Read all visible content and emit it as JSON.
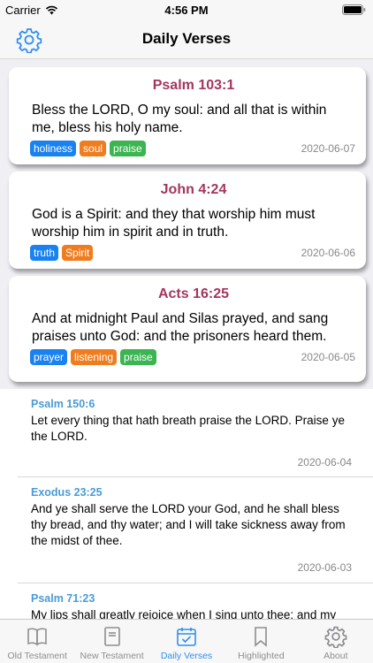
{
  "status": {
    "carrier": "Carrier",
    "time": "4:56 PM"
  },
  "nav": {
    "title": "Daily Verses"
  },
  "colors": {
    "accent": "#2f8ff0",
    "reference": "#a3365c",
    "list_reference": "#4a9bd6",
    "tag_blue": "#1a82f0",
    "tag_orange": "#ef7d20",
    "tag_green": "#3bb452"
  },
  "cards": [
    {
      "reference": "Psalm 103:1",
      "text": "Bless the LORD, O my soul: and all that is within me, bless his holy name.",
      "tags": [
        "holiness",
        "soul",
        "praise"
      ],
      "date": "2020-06-07"
    },
    {
      "reference": "John 4:24",
      "text": "God is a Spirit: and they that worship him must worship him in spirit and in truth.",
      "tags": [
        "truth",
        "Spirit"
      ],
      "date": "2020-06-06"
    },
    {
      "reference": "Acts 16:25",
      "text": "And at midnight Paul and Silas prayed, and sang praises unto God: and the prisoners heard them.",
      "tags": [
        "prayer",
        "listening",
        "praise"
      ],
      "date": "2020-06-05"
    }
  ],
  "list": [
    {
      "reference": "Psalm 150:6",
      "text": "Let every thing that hath breath praise the LORD. Praise ye the LORD.",
      "date": "2020-06-04"
    },
    {
      "reference": "Exodus 23:25",
      "text": "And ye shall serve the LORD your God, and he shall bless thy bread, and thy water; and I will take sickness away from the midst of thee.",
      "date": "2020-06-03"
    },
    {
      "reference": "Psalm 71:23",
      "text": "My lips shall greatly rejoice when I sing unto thee; and my soul, which thou hast redeemed.",
      "date": ""
    }
  ],
  "tabs": [
    {
      "label": "Old Testament",
      "icon": "book-open-icon"
    },
    {
      "label": "New Testament",
      "icon": "book-closed-icon"
    },
    {
      "label": "Daily Verses",
      "icon": "calendar-check-icon"
    },
    {
      "label": "Highlighted",
      "icon": "bookmark-icon"
    },
    {
      "label": "About",
      "icon": "gear-icon"
    }
  ]
}
